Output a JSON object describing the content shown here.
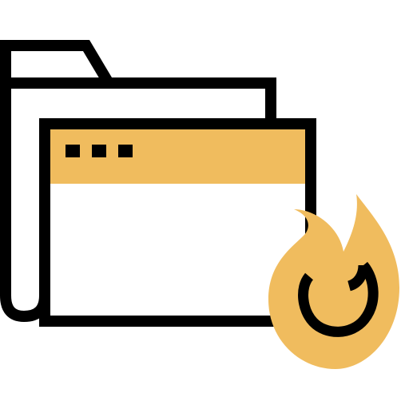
{
  "icon": {
    "name": "hot-folder-icon",
    "colors": {
      "outline": "#000000",
      "accent": "#F0BC5E",
      "fill": "#ffffff"
    },
    "parts": [
      "folder-back",
      "browser-window",
      "title-bar-dots",
      "flame"
    ]
  }
}
